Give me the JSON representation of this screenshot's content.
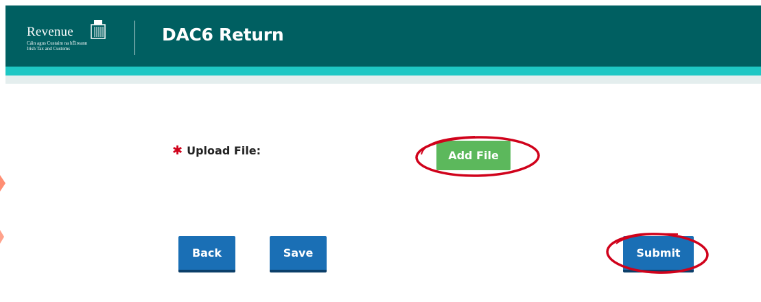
{
  "header": {
    "logo_name": "Revenue",
    "logo_sub_line1": "Cáin agus Custaim na hÉireann",
    "logo_sub_line2": "Irish Tax and Customs",
    "title": "DAC6 Return"
  },
  "form": {
    "required_marker": "✱",
    "upload_label": "Upload File:",
    "add_file_label": "Add File"
  },
  "actions": {
    "back_label": "Back",
    "save_label": "Save",
    "submit_label": "Submit"
  },
  "colors": {
    "header_bg": "#005f61",
    "accent_strip": "#1ec7c4",
    "primary_button": "#1a6fb5",
    "add_file_button": "#5cb85c",
    "required": "#d0021b",
    "annotation": "#d0021b"
  }
}
